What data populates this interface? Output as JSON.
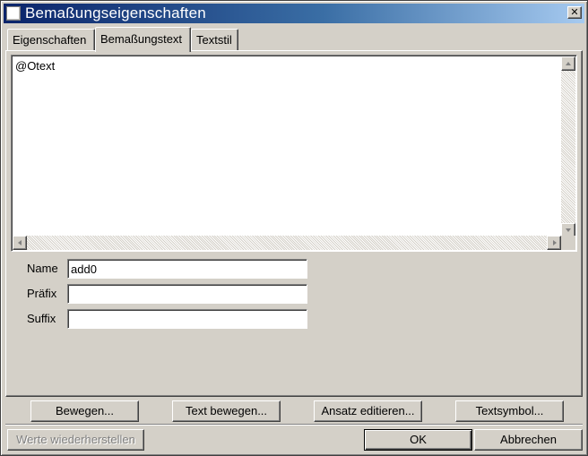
{
  "window": {
    "title": "Bemaßungseigenschaften",
    "close_glyph": "✕"
  },
  "tabs": [
    {
      "label": "Eigenschaften",
      "active": false
    },
    {
      "label": "Bemaßungstext",
      "active": true
    },
    {
      "label": "Textstil",
      "active": false
    }
  ],
  "text_area": {
    "content": "@Otext"
  },
  "fields": {
    "name": {
      "label": "Name",
      "value": "add0"
    },
    "prefix": {
      "label": "Präfix",
      "value": ""
    },
    "suffix": {
      "label": "Suffix",
      "value": ""
    }
  },
  "action_buttons": {
    "move": "Bewegen...",
    "move_text": "Text bewegen...",
    "edit_extension": "Ansatz editieren...",
    "text_symbol": "Textsymbol..."
  },
  "footer": {
    "restore": "Werte wiederherstellen",
    "ok": "OK",
    "cancel": "Abbrechen"
  },
  "colors": {
    "title_start": "#0a246a",
    "title_end": "#a6caf0",
    "face": "#d4d0c8"
  }
}
